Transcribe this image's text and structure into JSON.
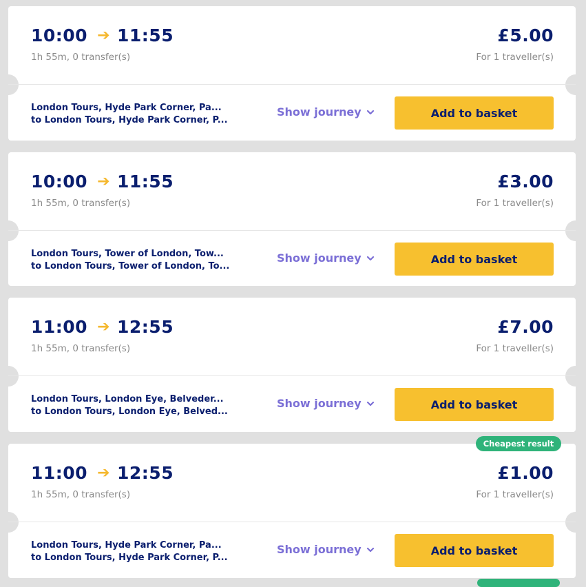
{
  "results": [
    {
      "depart": "10:00",
      "arrive": "11:55",
      "duration": "1h 55m, 0 transfer(s)",
      "price": "£5.00",
      "travellers": "For 1 traveller(s)",
      "from": "London Tours, Hyde Park Corner, Pa...",
      "to": "to London Tours, Hyde Park Corner, P...",
      "show_journey": "Show journey",
      "add_label": "Add to basket"
    },
    {
      "depart": "10:00",
      "arrive": "11:55",
      "duration": "1h 55m, 0 transfer(s)",
      "price": "£3.00",
      "travellers": "For 1 traveller(s)",
      "from": "London Tours, Tower of London, Tow...",
      "to": "to London Tours, Tower of London, To...",
      "show_journey": "Show journey",
      "add_label": "Add to basket"
    },
    {
      "depart": "11:00",
      "arrive": "12:55",
      "duration": "1h 55m, 0 transfer(s)",
      "price": "£7.00",
      "travellers": "For 1 traveller(s)",
      "from": "London Tours, London Eye, Belveder...",
      "to": "to London Tours, London Eye, Belved...",
      "show_journey": "Show journey",
      "add_label": "Add to basket"
    },
    {
      "depart": "11:00",
      "arrive": "12:55",
      "duration": "1h 55m, 0 transfer(s)",
      "price": "£1.00",
      "travellers": "For 1 traveller(s)",
      "from": "London Tours, Hyde Park Corner, Pa...",
      "to": "to London Tours, Hyde Park Corner, P...",
      "show_journey": "Show journey",
      "add_label": "Add to basket"
    }
  ],
  "badges": {
    "cheapest": "Cheapest result"
  },
  "colors": {
    "background": "#e0e0e0",
    "card": "#ffffff",
    "navy_text": "#0a1e6e",
    "accent_yellow": "#f7c02f",
    "arrow_yellow": "#f5b82e",
    "link_purple": "#7b6fd6",
    "badge_green": "#2fb37a"
  },
  "icons": {
    "arrow": "arrow-right-icon",
    "chevron": "chevron-down-icon"
  }
}
